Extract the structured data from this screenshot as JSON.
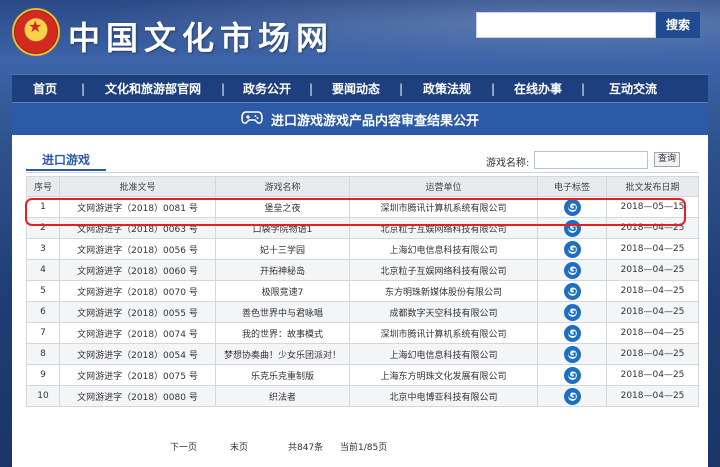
{
  "header": {
    "site_title": "中国文化市场网",
    "search_button": "搜索",
    "search_value": ""
  },
  "nav": {
    "items": [
      "首页",
      "文化和旅游部官网",
      "政务公开",
      "要闻动态",
      "政策法规",
      "在线办事",
      "互动交流"
    ]
  },
  "banner": {
    "icon": "gamepad-icon",
    "title": "进口游戏游戏产品内容审查结果公开"
  },
  "tab": {
    "label": "进口游戏"
  },
  "game_search": {
    "label": "游戏名称:",
    "value": "",
    "button": "查询"
  },
  "table": {
    "columns": [
      "序号",
      "批准文号",
      "游戏名称",
      "运营单位",
      "电子标签",
      "批文发布日期"
    ],
    "rows": [
      {
        "index": "1",
        "approval": "文网游进字（2018）0081 号",
        "game": "堡垒之夜",
        "operator": "深圳市腾讯计算机系统有限公司",
        "label_icon": "g-label-icon",
        "date": "2018—05—15"
      },
      {
        "index": "2",
        "approval": "文网游进字（2018）0063 号",
        "game": "口袋学院物语1",
        "operator": "北京粒子互娱网络科技有限公司",
        "label_icon": "g-label-icon",
        "date": "2018—04—25"
      },
      {
        "index": "3",
        "approval": "文网游进字（2018）0056 号",
        "game": "妃十三学园",
        "operator": "上海幻电信息科技有限公司",
        "label_icon": "g-label-icon",
        "date": "2018—04—25"
      },
      {
        "index": "4",
        "approval": "文网游进字（2018）0060 号",
        "game": "开拓神秘岛",
        "operator": "北京粒子互娱网络科技有限公司",
        "label_icon": "g-label-icon",
        "date": "2018—04—25"
      },
      {
        "index": "5",
        "approval": "文网游进字（2018）0070 号",
        "game": "极限竞速7",
        "operator": "东方明珠新媒体股份有限公司",
        "label_icon": "g-label-icon",
        "date": "2018—04—25"
      },
      {
        "index": "6",
        "approval": "文网游进字（2018）0055 号",
        "game": "善色世界中与君咏唱",
        "operator": "成都数字天空科技有限公司",
        "label_icon": "g-label-icon",
        "date": "2018—04—25"
      },
      {
        "index": "7",
        "approval": "文网游进字（2018）0074 号",
        "game": "我的世界：故事模式",
        "operator": "深圳市腾讯计算机系统有限公司",
        "label_icon": "g-label-icon",
        "date": "2018—04—25"
      },
      {
        "index": "8",
        "approval": "文网游进字（2018）0054 号",
        "game": "梦想协奏曲！少女乐团派对！",
        "operator": "上海幻电信息科技有限公司",
        "label_icon": "g-label-icon",
        "date": "2018—04—25"
      },
      {
        "index": "9",
        "approval": "文网游进字（2018）0075 号",
        "game": "乐克乐克重制版",
        "operator": "上海东方明珠文化发展有限公司",
        "label_icon": "g-label-icon",
        "date": "2018—04—25"
      },
      {
        "index": "10",
        "approval": "文网游进字（2018）0080 号",
        "game": "织法者",
        "operator": "北京中电博亚科技有限公司",
        "label_icon": "g-label-icon",
        "date": "2018—04—25"
      }
    ]
  },
  "pager": {
    "next": "下一页",
    "last": "末页",
    "total": "共847条",
    "current": "当前1/85页"
  },
  "colors": {
    "nav_bg": "#1d3f7e",
    "banner_bg": "#2c5aa6",
    "highlight": "#e22222"
  }
}
